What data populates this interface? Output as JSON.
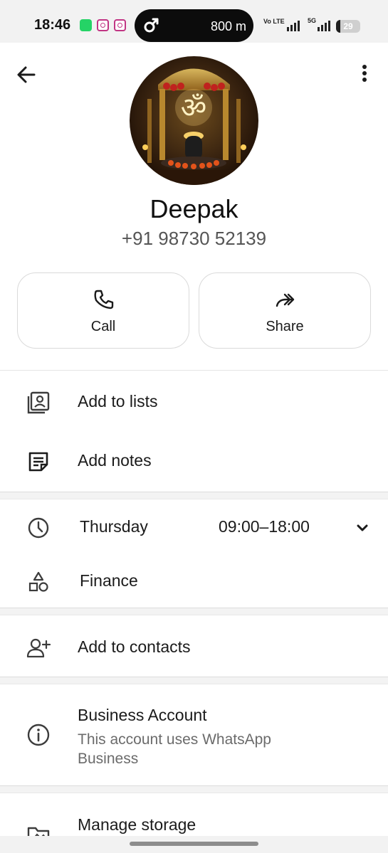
{
  "status_bar": {
    "time": "18:46",
    "apps": [
      "whatsapp-icon",
      "instagram-icon",
      "instagram-icon"
    ],
    "pill_text": "800 m",
    "volte": "Vo LTE",
    "network": "5G",
    "battery": "29"
  },
  "contact": {
    "name": "Deepak",
    "phone": "+91 98730 52139"
  },
  "actions": {
    "call_label": "Call",
    "share_label": "Share"
  },
  "menu": {
    "add_to_lists": "Add to lists",
    "add_notes": "Add notes"
  },
  "business_hours": {
    "day": "Thursday",
    "hours": "09:00–18:00",
    "category": "Finance"
  },
  "contacts": {
    "add_to_contacts": "Add to contacts"
  },
  "business_account": {
    "title": "Business Account",
    "subtitle": "This account uses WhatsApp Business"
  },
  "storage": {
    "label": "Manage storage"
  },
  "colors": {
    "icon": "#3c3c3c",
    "divider": "#e4e4e4",
    "secondary_text": "#6b6b6b"
  }
}
